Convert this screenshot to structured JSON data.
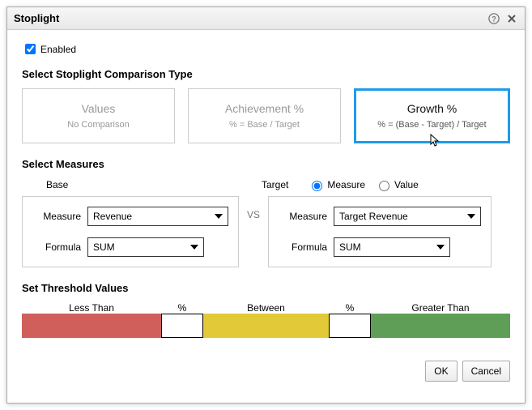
{
  "dialog": {
    "title": "Stoplight",
    "enabled_label": "Enabled",
    "enabled_checked": true
  },
  "comparison": {
    "heading": "Select Stoplight Comparison Type",
    "selected": "growth",
    "options": {
      "values": {
        "title": "Values",
        "sub": "No Comparison"
      },
      "achievement": {
        "title": "Achievement %",
        "sub": "% = Base / Target"
      },
      "growth": {
        "title": "Growth %",
        "sub": "% = (Base - Target) / Target"
      }
    }
  },
  "measures": {
    "heading": "Select Measures",
    "base_heading": "Base",
    "target_heading": "Target",
    "vs_label": "VS",
    "target_mode": {
      "measure_label": "Measure",
      "value_label": "Value",
      "selected": "measure"
    },
    "field_labels": {
      "measure": "Measure",
      "formula": "Formula"
    },
    "base": {
      "measure": "Revenue",
      "formula": "SUM"
    },
    "target": {
      "measure": "Target Revenue",
      "formula": "SUM"
    }
  },
  "thresholds": {
    "heading": "Set Threshold Values",
    "less_label": "Less Than",
    "between_label": "Between",
    "greater_label": "Greater Than",
    "percent_symbol": "%",
    "low_value": "",
    "high_value": "",
    "colors": {
      "low": "#d05f5c",
      "mid": "#e1c937",
      "high": "#5e9e57"
    }
  },
  "buttons": {
    "ok": "OK",
    "cancel": "Cancel"
  }
}
